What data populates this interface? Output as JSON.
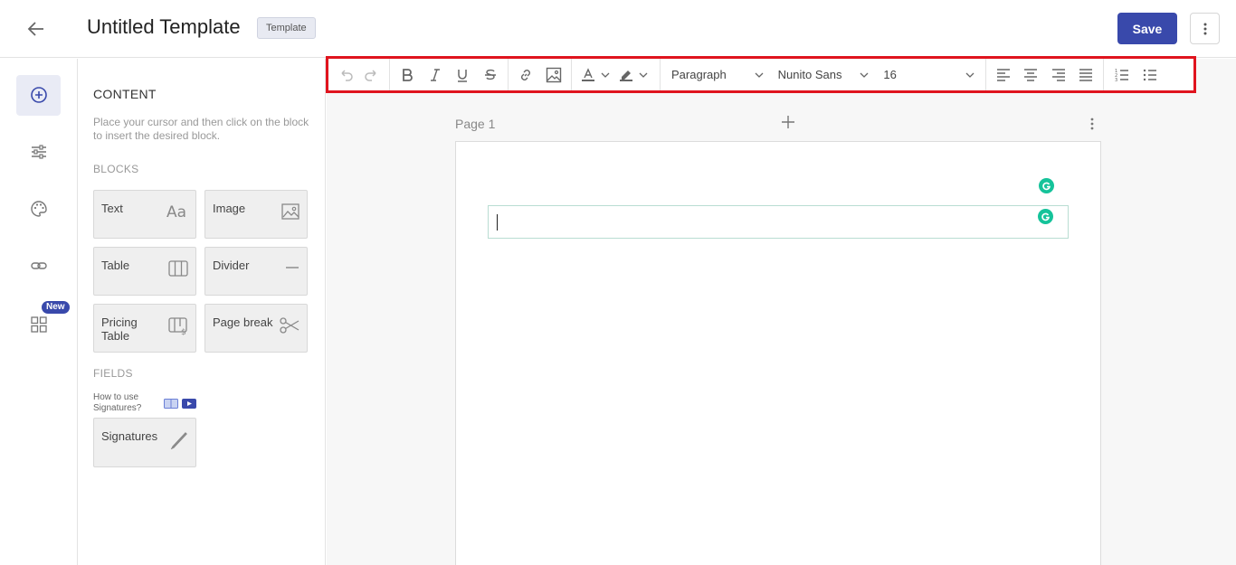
{
  "header": {
    "title": "Untitled Template",
    "tag": "Template",
    "save_label": "Save"
  },
  "rail": {
    "items": [
      {
        "name": "add-content",
        "icon": "plus-circle-icon",
        "active": true
      },
      {
        "name": "settings",
        "icon": "sliders-icon"
      },
      {
        "name": "theme",
        "icon": "palette-icon"
      },
      {
        "name": "links",
        "icon": "link-icon"
      },
      {
        "name": "apps",
        "icon": "grid-icon",
        "badge": "New"
      }
    ]
  },
  "panel": {
    "title": "CONTENT",
    "description": "Place your cursor and then click on the block to insert the desired block.",
    "blocks_label": "BLOCKS",
    "blocks": [
      {
        "label": "Text",
        "icon": "text-aa-icon"
      },
      {
        "label": "Image",
        "icon": "image-icon"
      },
      {
        "label": "Table",
        "icon": "table-icon"
      },
      {
        "label": "Divider",
        "icon": "divider-icon"
      },
      {
        "label": "Pricing Table",
        "icon": "pricing-table-icon"
      },
      {
        "label": "Page break",
        "icon": "scissors-icon"
      }
    ],
    "fields_label": "FIELDS",
    "how_to": "How to use Signatures?",
    "fields": [
      {
        "label": "Signatures",
        "icon": "pen-icon"
      }
    ]
  },
  "toolbar": {
    "block_style": "Paragraph",
    "font_family": "Nunito Sans",
    "font_size": "16"
  },
  "page": {
    "label": "Page 1"
  },
  "colors": {
    "accent": "#3949ab",
    "highlight_outline": "#e0141e",
    "grammarly": "#15c39a"
  }
}
